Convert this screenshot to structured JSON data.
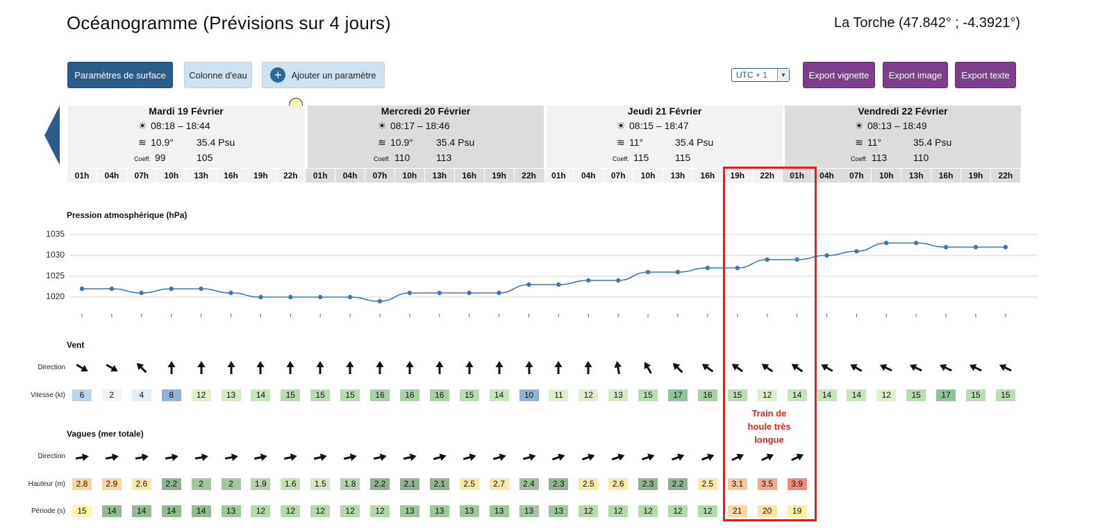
{
  "header": {
    "title": "Océanogramme (Prévisions sur 4 jours)",
    "location": "La Torche (47.842° ; -4.3921°)"
  },
  "toolbar": {
    "surface_btn": "Paramètres de surface",
    "water_btn": "Colonne d'eau",
    "add_btn": "Ajouter un paramètre",
    "timezone": "UTC + 1",
    "export_vignette": "Export vignette",
    "export_image": "Export image",
    "export_text": "Export texte"
  },
  "days": [
    {
      "title": "Mardi 19 Février",
      "sun": "08:18 – 18:44",
      "temp": "10.9°",
      "sal": "35.4 Psu",
      "coef_label": "Coeff.",
      "coef1": "99",
      "coef2": "105"
    },
    {
      "title": "Mercredi 20 Février",
      "sun": "08:17 – 18:46",
      "temp": "10.9°",
      "sal": "35.4 Psu",
      "coef_label": "Coeff.",
      "coef1": "110",
      "coef2": "113"
    },
    {
      "title": "Jeudi 21 Février",
      "sun": "08:15 – 18:47",
      "temp": "11°",
      "sal": "35.4 Psu",
      "coef_label": "Coeff.",
      "coef1": "115",
      "coef2": "115"
    },
    {
      "title": "Vendredi 22 Février",
      "sun": "08:13 – 18:49",
      "temp": "11°",
      "sal": "35.4 Psu",
      "coef_label": "Coeff.",
      "coef1": "113",
      "coef2": "110"
    }
  ],
  "hours": [
    "01h",
    "04h",
    "07h",
    "10h",
    "13h",
    "16h",
    "19h",
    "22h",
    "01h",
    "04h",
    "07h",
    "10h",
    "13h",
    "16h",
    "19h",
    "22h",
    "01h",
    "04h",
    "07h",
    "10h",
    "13h",
    "16h",
    "19h",
    "22h",
    "01h",
    "04h",
    "07h",
    "10h",
    "13h",
    "16h",
    "19h",
    "22h"
  ],
  "pressure": {
    "label": "Pression atmosphérique (hPa)",
    "yticks": [
      "1035",
      "1030",
      "1025",
      "1020"
    ]
  },
  "chart_data": {
    "type": "line",
    "title": "Pression atmosphérique (hPa)",
    "x": [
      "01h",
      "04h",
      "07h",
      "10h",
      "13h",
      "16h",
      "19h",
      "22h",
      "01h",
      "04h",
      "07h",
      "10h",
      "13h",
      "16h",
      "19h",
      "22h",
      "01h",
      "04h",
      "07h",
      "10h",
      "13h",
      "16h",
      "19h",
      "22h",
      "01h",
      "04h",
      "07h",
      "10h",
      "13h",
      "16h",
      "19h",
      "22h"
    ],
    "values": [
      1022,
      1022,
      1021,
      1022,
      1022,
      1021,
      1020,
      1020,
      1020,
      1020,
      1019,
      1021,
      1021,
      1021,
      1021,
      1023,
      1023,
      1024,
      1024,
      1026,
      1026,
      1027,
      1027,
      1029,
      1029,
      1030,
      1031,
      1033,
      1033,
      1032,
      1032,
      1032
    ],
    "ylim": [
      1020,
      1035
    ],
    "color": "#3d78ae"
  },
  "wind": {
    "label": "Vent",
    "dir_label": "Direction",
    "speed_label": "Vitesse (kt)",
    "directions": [
      120,
      120,
      -45,
      0,
      0,
      0,
      0,
      0,
      0,
      0,
      0,
      0,
      0,
      0,
      0,
      0,
      0,
      0,
      -10,
      -30,
      -45,
      -55,
      -55,
      -55,
      -55,
      -60,
      -60,
      -65,
      -65,
      -65,
      -65,
      -65
    ],
    "speeds": [
      "6",
      "2",
      "4",
      "8",
      "12",
      "13",
      "14",
      "15",
      "15",
      "15",
      "16",
      "16",
      "16",
      "15",
      "14",
      "10",
      "11",
      "12",
      "13",
      "15",
      "17",
      "16",
      "15",
      "12",
      "14",
      "14",
      "14",
      "12",
      "15",
      "17",
      "15",
      "15"
    ]
  },
  "waves": {
    "label": "Vagues (mer totale)",
    "dir_label": "Direction",
    "height_label": "Hauteur (m)",
    "period_label": "Période (s)",
    "directions": [
      80,
      80,
      80,
      80,
      80,
      80,
      78,
      78,
      78,
      78,
      78,
      78,
      75,
      75,
      75,
      75,
      72,
      72,
      72,
      72,
      70,
      70,
      65,
      65,
      65
    ],
    "heights": [
      "2.8",
      "2.9",
      "2.6",
      "2.2",
      "2",
      "2",
      "1.9",
      "1.6",
      "1.5",
      "1.8",
      "2.2",
      "2.1",
      "2.1",
      "2.5",
      "2.7",
      "2.4",
      "2.3",
      "2.5",
      "2.6",
      "2.3",
      "2.2",
      "2.5",
      "3.1",
      "3.5",
      "3.9"
    ],
    "periods": [
      "15",
      "14",
      "14",
      "14",
      "14",
      "13",
      "12",
      "12",
      "12",
      "12",
      "12",
      "13",
      "13",
      "13",
      "13",
      "13",
      "13",
      "12",
      "12",
      "12",
      "12",
      "12",
      "21",
      "20",
      "19"
    ]
  },
  "annotation": "Train de\nhoule très\nlongue"
}
